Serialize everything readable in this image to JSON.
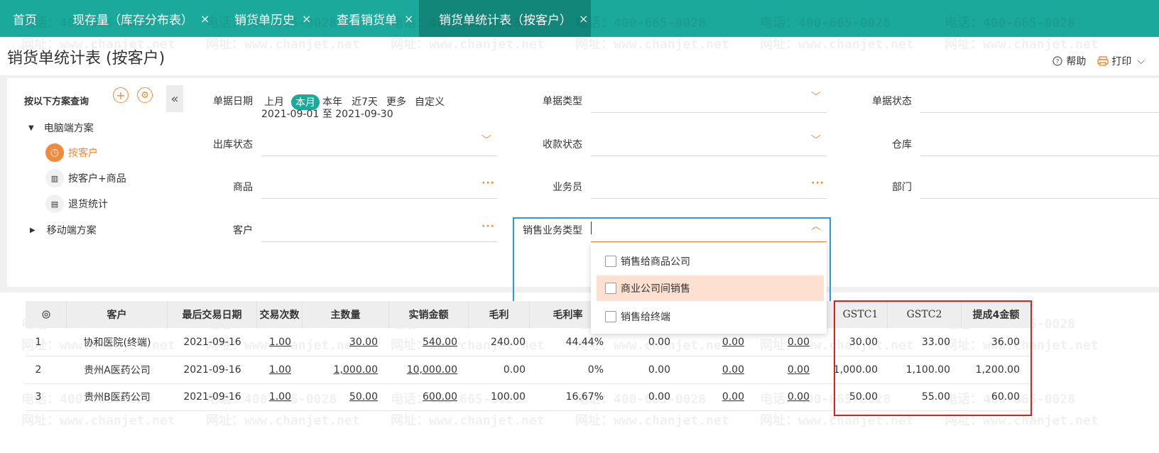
{
  "tabs": [
    {
      "label": "首页",
      "closable": false
    },
    {
      "label": "现存量（库存分布表）",
      "closable": true
    },
    {
      "label": "销货单历史",
      "closable": true
    },
    {
      "label": "查看销货单",
      "closable": true
    },
    {
      "label": "销货单统计表（按客户）",
      "closable": true,
      "active": true
    }
  ],
  "close_glyph": "×",
  "page_title": "销货单统计表 (按客户)",
  "top_actions": {
    "help": "帮助",
    "print": "打印"
  },
  "scheme_panel": {
    "title": "按以下方案查询",
    "groups": [
      {
        "label": "电脑端方案",
        "expanded": true,
        "items": [
          {
            "label": "按客户",
            "active": true,
            "icon": "clock-icon"
          },
          {
            "label": "按客户+商品",
            "active": false,
            "icon": "chart-icon"
          },
          {
            "label": "退货统计",
            "active": false,
            "icon": "doc-icon"
          }
        ]
      },
      {
        "label": "移动端方案",
        "expanded": false,
        "items": []
      }
    ]
  },
  "filters": {
    "doc_date": {
      "label": "单据日期",
      "options": [
        "上月",
        "本月",
        "本年",
        "近7天",
        "更多",
        "自定义"
      ],
      "selected": "本月",
      "range": "2021-09-01 至 2021-09-30"
    },
    "doc_type": {
      "label": "单据类型",
      "value": ""
    },
    "doc_status": {
      "label": "单据状态",
      "value": ""
    },
    "out_status": {
      "label": "出库状态",
      "value": ""
    },
    "pay_status": {
      "label": "收款状态",
      "value": ""
    },
    "warehouse": {
      "label": "仓库",
      "value": ""
    },
    "product": {
      "label": "商品",
      "value": ""
    },
    "salesman": {
      "label": "业务员",
      "value": ""
    },
    "department": {
      "label": "部门",
      "value": ""
    },
    "customer": {
      "label": "客户",
      "value": ""
    },
    "sale_biz_type": {
      "label": "销售业务类型",
      "value": "",
      "options": [
        "销售给商品公司",
        "商业公司间销售",
        "销售给终端"
      ],
      "highlighted": "商业公司间销售"
    }
  },
  "table": {
    "columns": [
      "客户",
      "最后交易日期",
      "交易次数",
      "主数量",
      "实销金额",
      "毛利",
      "毛利率",
      "",
      "",
      "",
      "GSTC1",
      "GSTC2",
      "提成4金额"
    ],
    "rows": [
      {
        "no": "1",
        "customer": "协和医院(终端)",
        "last_date": "2021-09-16",
        "count": "1.00",
        "qty": "30.00",
        "amount": "540.00",
        "profit": "240.00",
        "rate": "44.44%",
        "c8": "0.00",
        "c9": "0.00",
        "c10": "0.00",
        "gstc1": "30.00",
        "gstc2": "33.00",
        "comm4": "36.00"
      },
      {
        "no": "2",
        "customer": "贵州A医药公司",
        "last_date": "2021-09-16",
        "count": "1.00",
        "qty": "1,000.00",
        "amount": "10,000.00",
        "profit": "0.00",
        "rate": "0%",
        "c8": "0.00",
        "c9": "0.00",
        "c10": "0.00",
        "gstc1": "1,000.00",
        "gstc2": "1,100.00",
        "comm4": "1,200.00"
      },
      {
        "no": "3",
        "customer": "贵州B医药公司",
        "last_date": "2021-09-16",
        "count": "1.00",
        "qty": "50.00",
        "amount": "600.00",
        "profit": "100.00",
        "rate": "16.67%",
        "c8": "0.00",
        "c9": "0.00",
        "c10": "0.00",
        "gstc1": "50.00",
        "gstc2": "55.00",
        "comm4": "60.00"
      }
    ]
  },
  "watermark": {
    "phone": "电话：400-665-0028",
    "site": "网址：www.chanjet.net"
  },
  "colors": {
    "teal": "#1aa99a",
    "orange": "#f08a3c",
    "red_highlight": "#e02020",
    "blue_focus": "#2a9bd8"
  }
}
